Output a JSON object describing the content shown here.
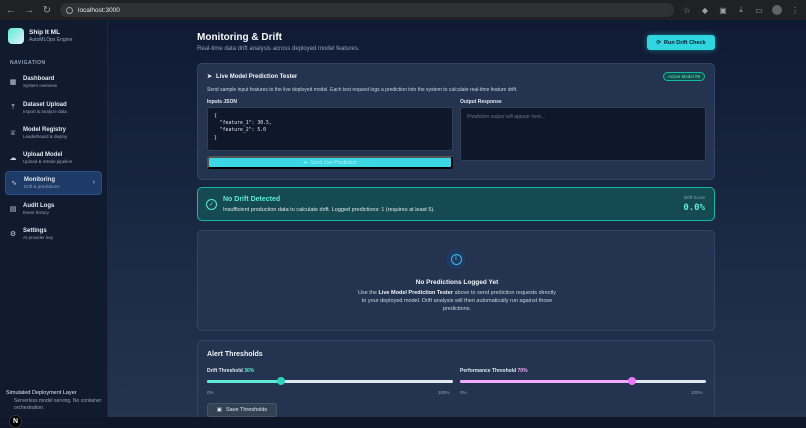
{
  "browser": {
    "url": "localhost:3000"
  },
  "brand": {
    "title": "Ship It ML",
    "subtitle": "AutoMLOps Engine"
  },
  "sidebar": {
    "heading": "NAVIGATION",
    "items": [
      {
        "label": "Dashboard",
        "sub": "System overview",
        "icon": "dashboard-icon"
      },
      {
        "label": "Dataset Upload",
        "sub": "Import & analyze data",
        "icon": "upload-icon"
      },
      {
        "label": "Model Registry",
        "sub": "Leaderboard & deploy",
        "icon": "trophy-icon"
      },
      {
        "label": "Upload Model",
        "sub": "Upload & retrain pipeline",
        "icon": "cloud-upload-icon"
      },
      {
        "label": "Monitoring",
        "sub": "Drift & predictions",
        "icon": "activity-icon",
        "active": true
      },
      {
        "label": "Audit Logs",
        "sub": "Event history",
        "icon": "log-icon"
      },
      {
        "label": "Settings",
        "sub": "AI provider key",
        "icon": "gear-icon"
      }
    ],
    "footer": {
      "title": "Simulated Deployment Layer",
      "text": "Serverless model serving. No container orchestration."
    }
  },
  "header": {
    "title": "Monitoring & Drift",
    "subtitle": "Real-time data drift analysis across deployed model features.",
    "run_button": "Run Drift Check"
  },
  "tester": {
    "title": "Live Model Prediction Tester",
    "badge": "Active Model #8",
    "description": "Send sample input features to the live deployed model. Each test request logs a prediction into the system to calculate real-time feature drift.",
    "input_label": "Inputs JSON",
    "input_value": "{\n  \"feature_1\": 30.5,\n  \"feature_2\": 5.0\n}",
    "output_label": "Output Response",
    "output_placeholder": "Prediction output will appear here...",
    "send_button": "Send Live Prediction"
  },
  "drift": {
    "title": "No Drift Detected",
    "text": "Insufficient production data to calculate drift. Logged predictions: 1 (requires at least 5).",
    "score_label": "Drift Score",
    "score_value": "0.0%"
  },
  "empty_state": {
    "title": "No Predictions Logged Yet",
    "text_before": "Use the ",
    "text_bold": "Live Model Prediction Tester",
    "text_after": " above to send prediction requests directly to your deployed model. Drift analysis will then automatically run against those predictions."
  },
  "thresholds": {
    "title": "Alert Thresholds",
    "drift_label": "Drift Threshold",
    "drift_value": "30%",
    "drift_fraction": 0.3,
    "perf_label": "Performance Threshold",
    "perf_value": "70%",
    "perf_fraction": 0.7,
    "min_tick": "0%",
    "max_tick": "100%",
    "save_button": "Save Thresholds"
  },
  "colors": {
    "accent": "#2fd6e0",
    "success": "#5eead4",
    "pink": "#f0abfc"
  }
}
